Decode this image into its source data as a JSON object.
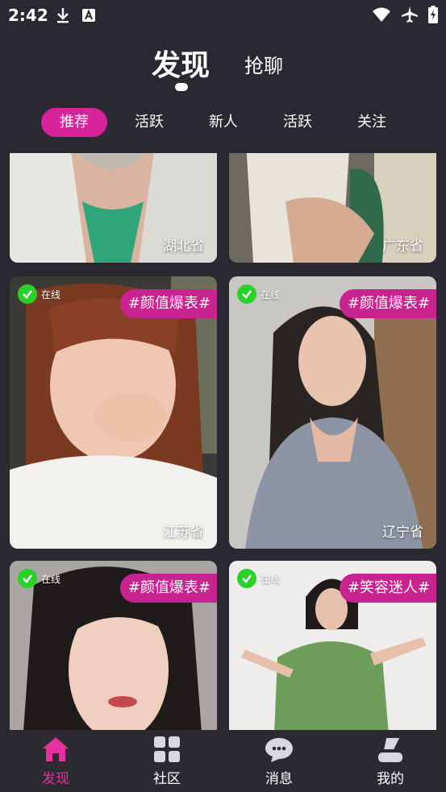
{
  "status_bar": {
    "time": "2:42"
  },
  "header": {
    "active_tab": "发现",
    "other_tab": "抢聊"
  },
  "filters": [
    "推荐",
    "活跃",
    "新人",
    "活跃",
    "关注"
  ],
  "cards": [
    {
      "location": "湖北省"
    },
    {
      "location": "广东省"
    },
    {
      "location": "江苏省",
      "online": "在线",
      "tag": "#颜值爆表#"
    },
    {
      "location": "辽宁省",
      "online": "在线",
      "tag": "#颜值爆表#"
    },
    {
      "online": "在线",
      "tag": "#颜值爆表#"
    },
    {
      "online": "在线",
      "tag": "#笑容迷人#"
    }
  ],
  "nav": [
    {
      "label": "发现",
      "icon": "home-icon"
    },
    {
      "label": "社区",
      "icon": "grid-icon"
    },
    {
      "label": "消息",
      "icon": "chat-icon"
    },
    {
      "label": "我的",
      "icon": "person-icon"
    }
  ],
  "colors": {
    "background": "#2a2830",
    "accent": "#d8249a",
    "tag": "#c9238f",
    "online": "#2bd12b",
    "nav_active": "#e6309f"
  }
}
